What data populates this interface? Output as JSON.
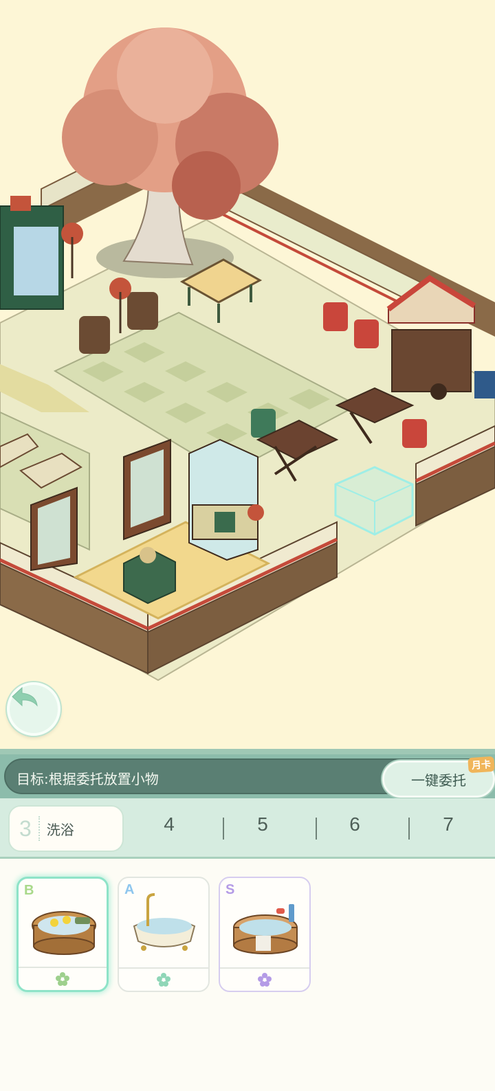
{
  "scene": {
    "back_button_icon": "back-arrow-icon"
  },
  "goal": {
    "text": "目标:根据委托放置小物",
    "delegate_label": "一键委托",
    "badge": "月卡"
  },
  "tabs": {
    "active": {
      "number": "3",
      "name": "洗浴"
    },
    "others": [
      "4",
      "5",
      "6",
      "7"
    ]
  },
  "items": [
    {
      "grade": "B",
      "grade_color": "#a9d98a",
      "icon": "wooden-tub-icon",
      "footer_icon": "flower-icon",
      "footer_color": "#9ed08d",
      "selected": true
    },
    {
      "grade": "A",
      "grade_color": "#8ec6ee",
      "icon": "clawfoot-bathtub-icon",
      "footer_icon": "flower-icon",
      "footer_color": "#8fd6b7",
      "selected": false
    },
    {
      "grade": "S",
      "grade_color": "#b49be6",
      "icon": "wooden-bathtub-toiletries-icon",
      "footer_icon": "flower-icon",
      "footer_color": "#b49be6",
      "selected": false
    }
  ]
}
